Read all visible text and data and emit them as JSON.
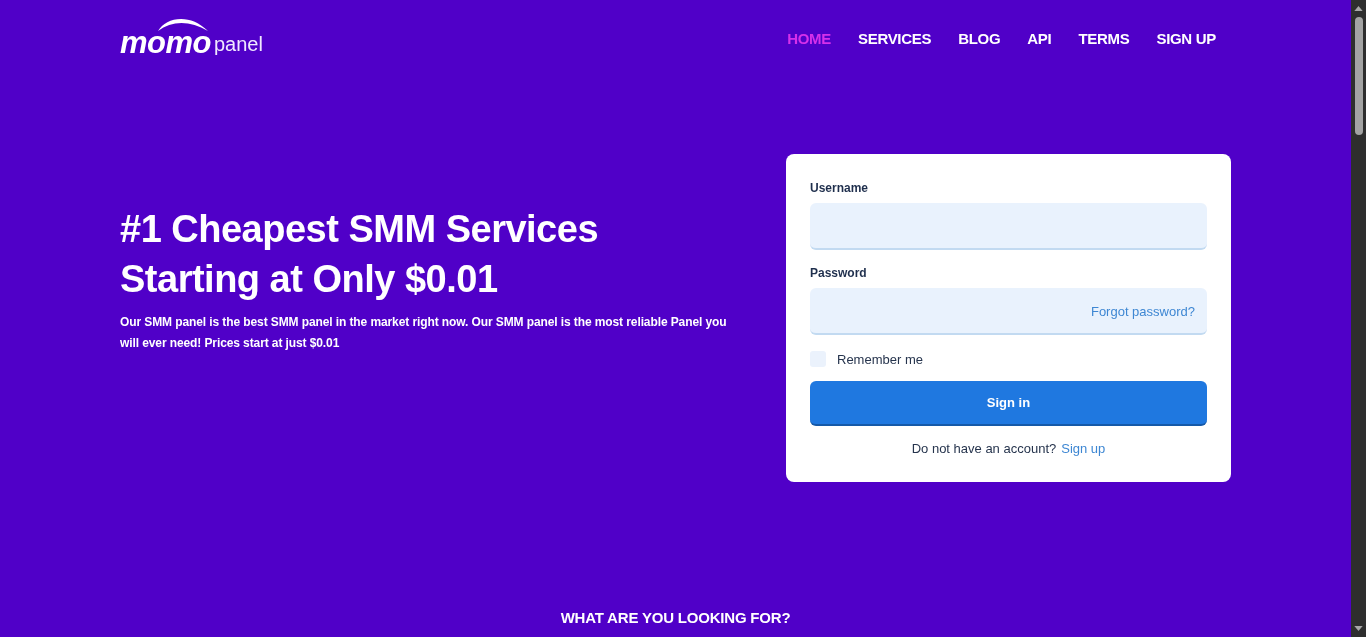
{
  "header": {
    "logo": {
      "wordmark": "momo",
      "suffix": "panel"
    },
    "nav": [
      {
        "label": "HOME",
        "selected": true
      },
      {
        "label": "SERVICES",
        "selected": false
      },
      {
        "label": "BLOG",
        "selected": false
      },
      {
        "label": "API",
        "selected": false
      },
      {
        "label": "TERMS",
        "selected": false
      },
      {
        "label": "SIGN UP",
        "selected": false
      }
    ]
  },
  "hero": {
    "title": "#1 Cheapest SMM Services Starting at Only $0.01",
    "text": "Our SMM panel is the best SMM panel in the market right now. Our SMM panel is the most reliable Panel you will ever need! Prices start at just $0.01"
  },
  "login_form": {
    "fields": [
      {
        "label": "Username"
      },
      {
        "label": "Password",
        "link": "Forgot password?"
      }
    ],
    "remember": {
      "label": "Remember me",
      "checked": false
    },
    "submit": "Sign in",
    "signup": {
      "text": "Do not have an account?",
      "link": "Sign up"
    }
  },
  "section": {
    "title": "WHAT ARE YOU LOOKING FOR?"
  }
}
